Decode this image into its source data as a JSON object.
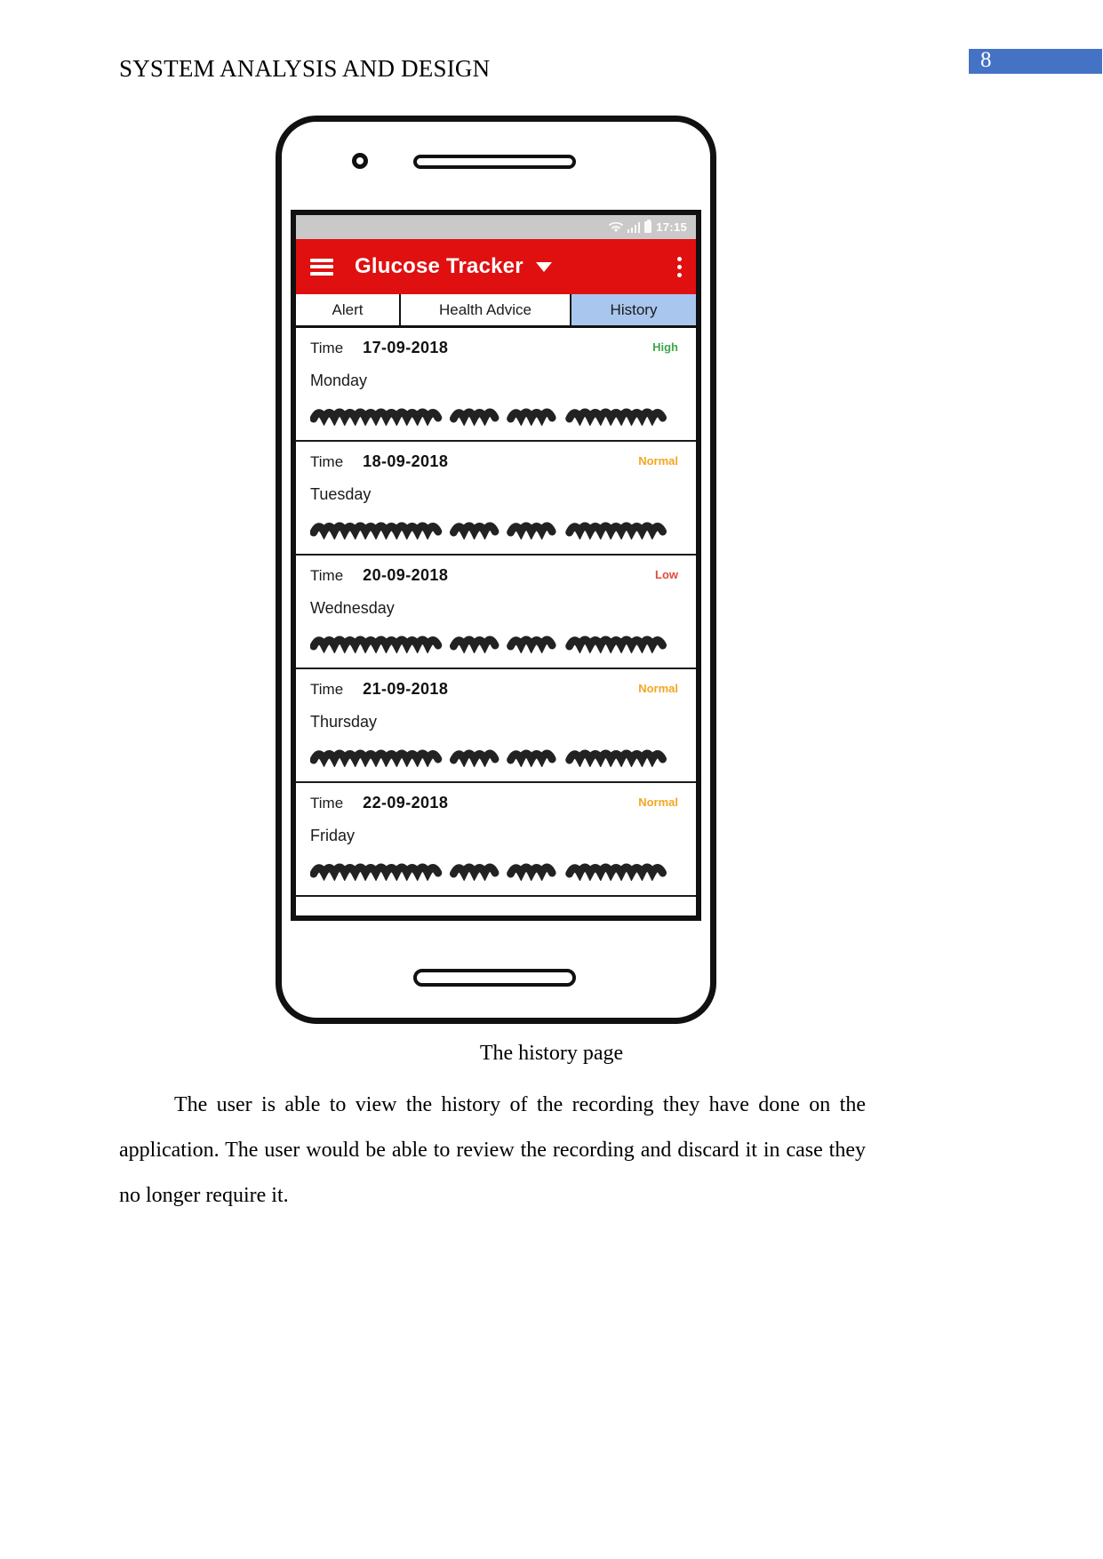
{
  "document": {
    "header_title": "SYSTEM ANALYSIS AND DESIGN",
    "page_number": "8",
    "page_badge_color": "#4472C4",
    "caption": "The history page",
    "body_paragraph": "The user is able to view the history of the recording they have done on the application. The user would be able to review the recording and discard it in case they no longer require it."
  },
  "phone": {
    "statusbar": {
      "time": "17:15",
      "icons": [
        "wifi-icon",
        "signal-bars-icon",
        "battery-icon"
      ],
      "background": "#c9c9c9"
    },
    "appbar": {
      "menu_icon": "hamburger-icon",
      "title": "Glucose Tracker",
      "dropdown_icon": "chevron-down-icon",
      "overflow_icon": "kebab-menu-icon",
      "background": "#E01010"
    },
    "tabs": [
      {
        "label": "Alert",
        "selected": false
      },
      {
        "label": "Health Advice",
        "selected": false
      },
      {
        "label": "History",
        "selected": true
      }
    ],
    "tab_selected_color": "#A9C6EE",
    "history": {
      "time_label": "Time",
      "status_colors": {
        "High": "#3FA64B",
        "Normal": "#F5A623",
        "Low": "#E04B3C"
      },
      "entries": [
        {
          "time_label": "Time",
          "date": "17-09-2018",
          "day": "Monday",
          "status": "High"
        },
        {
          "time_label": "Time",
          "date": "18-09-2018",
          "day": "Tuesday",
          "status": "Normal"
        },
        {
          "time_label": "Time",
          "date": "20-09-2018",
          "day": "Wednesday",
          "status": "Low"
        },
        {
          "time_label": "Time",
          "date": "21-09-2018",
          "day": "Thursday",
          "status": "Normal"
        },
        {
          "time_label": "Time",
          "date": "22-09-2018",
          "day": "Friday",
          "status": "Normal"
        }
      ]
    }
  }
}
